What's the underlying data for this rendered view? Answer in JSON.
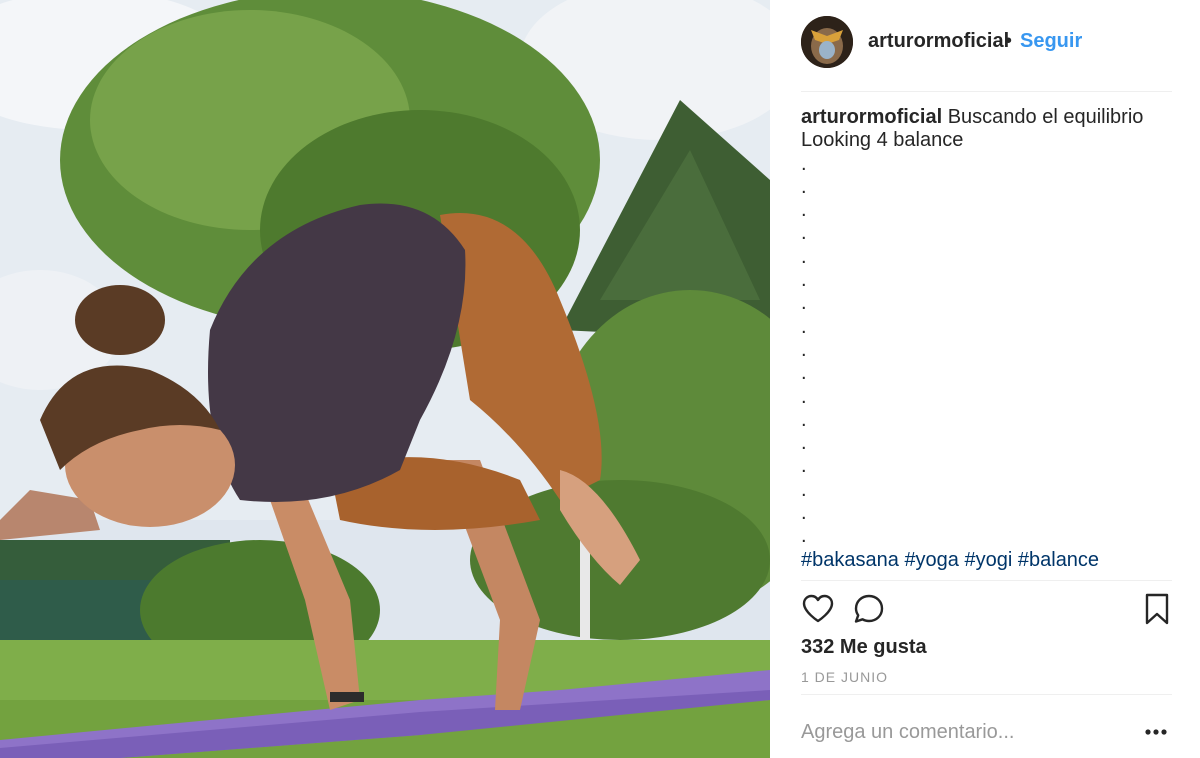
{
  "post": {
    "username": "arturormoficial",
    "separator": "•",
    "follow_label": "Seguir",
    "caption_line1": "Buscando el equilibrio",
    "caption_line2": "Looking 4 balance",
    "caption_dots": [
      ".",
      ".",
      ".",
      ".",
      ".",
      ".",
      ".",
      ".",
      ".",
      ".",
      ".",
      ".",
      ".",
      ".",
      ".",
      ".",
      "."
    ],
    "hashtags": [
      "#bakasana",
      "#yoga",
      "#yogi",
      "#balance"
    ],
    "likes": "332 Me gusta",
    "date": "1 DE JUNIO",
    "comment_placeholder": "Agrega un comentario..."
  },
  "icons": {
    "like": "heart-icon",
    "comment": "comment-bubble-icon",
    "save": "bookmark-icon",
    "more": "more-options-icon"
  },
  "colors": {
    "follow": "#3897f0",
    "text": "#262626",
    "muted": "#999999",
    "hashtag": "#003569",
    "divider": "#efefef"
  }
}
